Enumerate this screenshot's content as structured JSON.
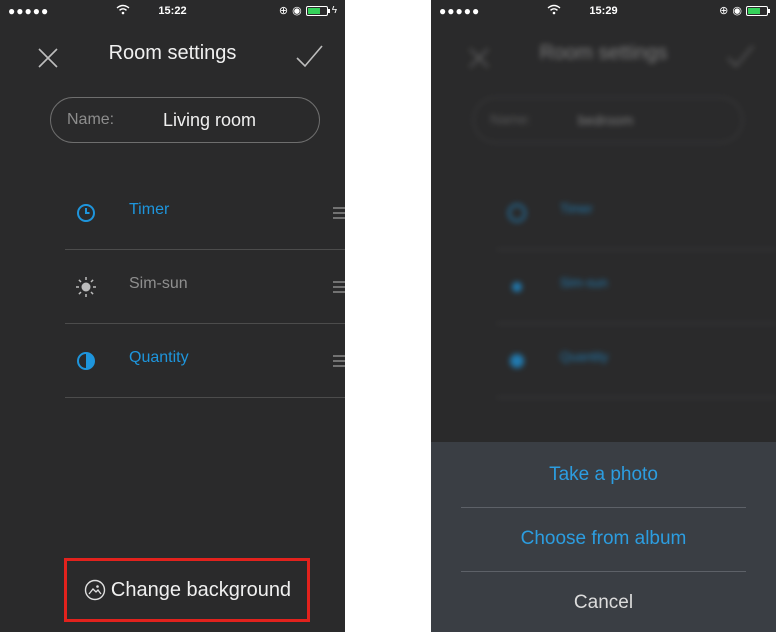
{
  "left": {
    "status": {
      "signal": "●●●●●",
      "time": "15:22"
    },
    "nav": {
      "title": "Room settings"
    },
    "name_field": {
      "label": "Name:",
      "value": "Living room"
    },
    "rows": [
      {
        "label": "Timer",
        "icon": "clock-icon"
      },
      {
        "label": "Sim-sun",
        "icon": "sun-icon"
      },
      {
        "label": "Quantity",
        "icon": "half-circle-icon"
      }
    ],
    "change_background": "Change background"
  },
  "right": {
    "status": {
      "signal": "●●●●●",
      "time": "15:29"
    },
    "nav": {
      "title": "Room settings"
    },
    "name_field": {
      "label": "Name:",
      "value": "bedroom"
    },
    "rows": [
      {
        "label": "Timer"
      },
      {
        "label": "Sim-sun"
      },
      {
        "label": "Quantity"
      }
    ],
    "sheet": {
      "take_photo": "Take a photo",
      "choose_album": "Choose from album",
      "cancel": "Cancel"
    }
  },
  "colors": {
    "accent": "#1e95dc",
    "highlight_border": "#e2221d",
    "background": "#2a2a2b"
  }
}
